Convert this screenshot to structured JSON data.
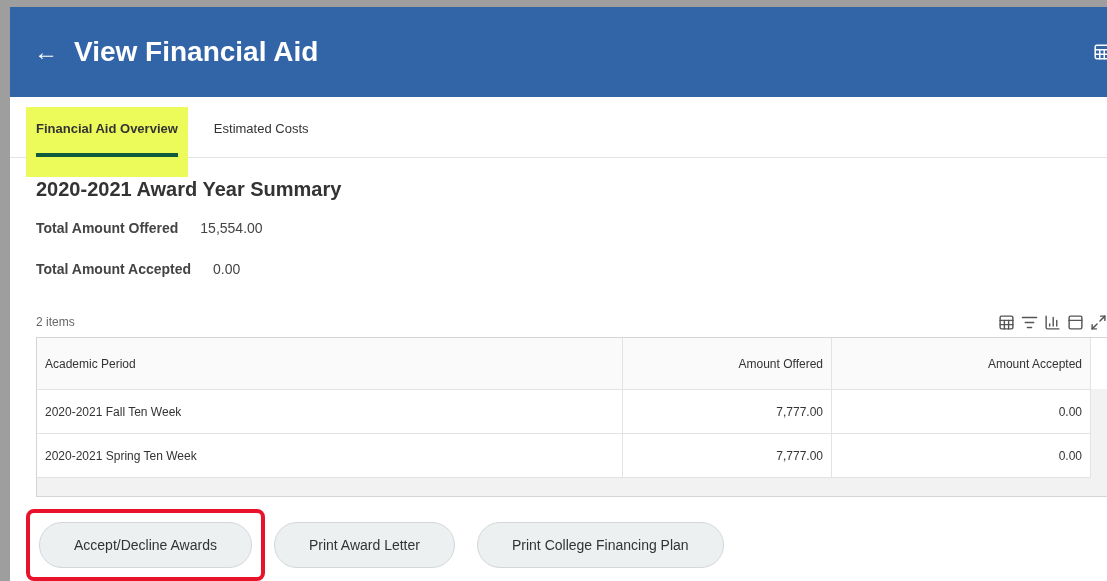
{
  "header": {
    "back": "←",
    "title": "View Financial Aid"
  },
  "tabs": [
    {
      "label": "Financial Aid Overview",
      "selected": true,
      "highlighted": true
    },
    {
      "label": "Estimated Costs",
      "selected": false,
      "highlighted": false
    }
  ],
  "summary": {
    "heading": "2020-2021 Award Year Summary",
    "fields": [
      {
        "label": "Total Amount Offered",
        "value": "15,554.00"
      },
      {
        "label": "Total Amount Accepted",
        "value": "0.00"
      }
    ]
  },
  "table": {
    "count": "2 items",
    "columns": [
      "Academic Period",
      "Amount Offered",
      "Amount Accepted"
    ],
    "rows": [
      [
        "2020-2021 Fall Ten Week",
        "7,777.00",
        "0.00"
      ],
      [
        "2020-2021 Spring Ten Week",
        "7,777.00",
        "0.00"
      ]
    ]
  },
  "buttons": [
    {
      "label": "Accept/Decline Awards",
      "outlined": true
    },
    {
      "label": "Print Award Letter",
      "outlined": false
    },
    {
      "label": "Print College Financing Plan",
      "outlined": false
    }
  ]
}
